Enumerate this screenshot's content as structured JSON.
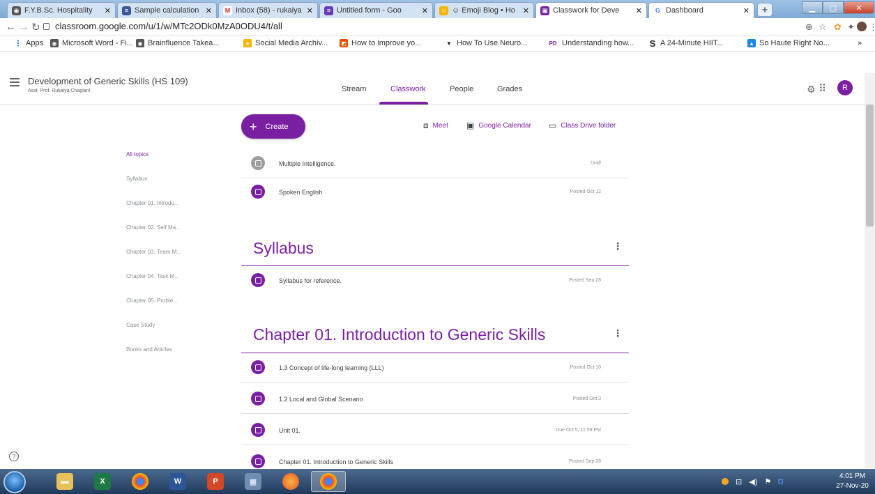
{
  "browser": {
    "tabs": [
      {
        "title": "F.Y.B.Sc. Hospitality",
        "fav_color": "#555555",
        "fav_glyph": "◉"
      },
      {
        "title": "Sample calculation",
        "fav_color": "#3b5998",
        "fav_glyph": "≡"
      },
      {
        "title": "Inbox (58) - rukaiya",
        "fav_color": "#d93025",
        "fav_glyph": "M"
      },
      {
        "title": "Untitled form - Goo",
        "fav_color": "#673ab7",
        "fav_glyph": "≡"
      },
      {
        "title": "☺ Emoji Blog • Ho",
        "fav_color": "#f4b400",
        "fav_glyph": "☺"
      },
      {
        "title": "Classwork for Deve",
        "fav_color": "#7b1fa2",
        "fav_glyph": "▣"
      },
      {
        "title": "Dashboard",
        "fav_color": "#4285f4",
        "fav_glyph": "G"
      }
    ],
    "new_tab_label": "+",
    "url": "classroom.google.com/u/1/w/MTc2ODk0MzA0ODU4/t/all",
    "bookmarks": [
      {
        "label": "Apps",
        "color": "#4285f4",
        "glyph": "⋮"
      },
      {
        "label": "Microsoft Word - Fi...",
        "color": "#555555",
        "glyph": "◉"
      },
      {
        "label": "Brainfluence Takea...",
        "color": "#555555",
        "glyph": "◉"
      },
      {
        "label": "Social Media Archiv...",
        "color": "#f4b400",
        "glyph": "★"
      },
      {
        "label": "How to improve yo...",
        "color": "#e65100",
        "glyph": "◩"
      },
      {
        "label": "How To Use Neuro...",
        "color": "#222222",
        "glyph": "▼"
      },
      {
        "label": "Understanding how...",
        "color": "#7b1fa2",
        "glyph": "PD"
      },
      {
        "label": "A 24-Minute HIIT...",
        "color": "#222222",
        "glyph": "S"
      },
      {
        "label": "So Haute Right No...",
        "color": "#1e88e5",
        "glyph": "▲"
      }
    ],
    "bookmarks_more": "»"
  },
  "classroom": {
    "course_title": "Development of Generic Skills (HS 109)",
    "teacher": "Asst. Prof. Rukaiya Chaglani",
    "tabs": [
      "Stream",
      "Classwork",
      "People",
      "Grades"
    ],
    "active_tab": "Classwork",
    "avatar_letter": "R",
    "accent_color": "#7b1fa2",
    "create_label": "Create",
    "meet_label": "Meet",
    "calendar_label": "Google Calendar",
    "drive_label": "Class Drive folder",
    "topics": [
      "All topics",
      "Syllabus",
      "Chapter 01. Introdu...",
      "Chapter 02. Self Ma...",
      "Chapter 03. Team M...",
      "Chapter 04. Task M...",
      "Chapter 05. Proble...",
      "Case Study",
      "Books and Articles"
    ],
    "ungrouped_items": [
      {
        "name": "Multiple Intelligence.",
        "meta": "Draft",
        "type": "draft"
      },
      {
        "name": "Spoken English",
        "meta": "Posted Oct 12",
        "type": "material"
      }
    ],
    "sections": [
      {
        "title": "Syllabus",
        "items": [
          {
            "name": "Syllabus for reference.",
            "meta": "Posted Sep 28",
            "type": "material"
          }
        ]
      },
      {
        "title": "Chapter 01. Introduction to Generic Skills",
        "items": [
          {
            "name": "1.3 Concept of life-long learning (LLL)",
            "meta": "Posted Oct 10",
            "type": "material"
          },
          {
            "name": "1.2 Local and Global Scenario",
            "meta": "Posted Oct 3",
            "type": "material"
          },
          {
            "name": "Unit 01.",
            "meta": "Due Oct 5, 11:59 PM",
            "type": "assignment"
          },
          {
            "name": "Chapter 01. Introduction to Generic Skills",
            "meta": "Posted Sep 28",
            "type": "material"
          }
        ]
      }
    ]
  },
  "taskbar": {
    "time": "4:01 PM",
    "date": "27-Nov-20"
  }
}
